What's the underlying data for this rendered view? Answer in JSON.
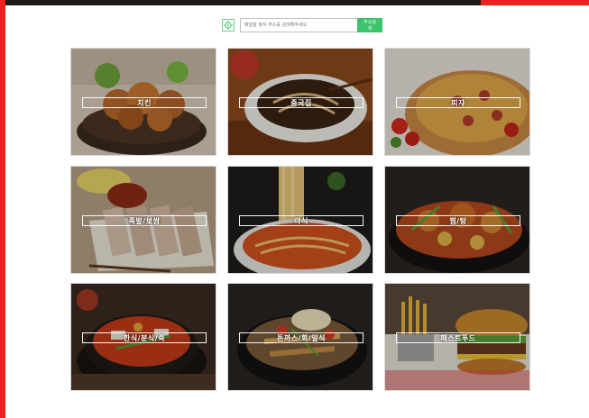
{
  "search": {
    "placeholder": "배달을 놓지 주소를 검색해주세요",
    "button_label": "주소검색"
  },
  "categories": [
    {
      "label": "치킨",
      "icon": "fried-chicken-image"
    },
    {
      "label": "중국집",
      "icon": "jjajangmyeon-image"
    },
    {
      "label": "피자",
      "icon": "pizza-image"
    },
    {
      "label": "족발/보쌈",
      "icon": "bossam-image"
    },
    {
      "label": "야식",
      "icon": "ramen-image"
    },
    {
      "label": "찜/탕",
      "icon": "braised-dish-image"
    },
    {
      "label": "한식/분식/죽",
      "icon": "stew-image"
    },
    {
      "label": "돈까스/회/일식",
      "icon": "donkatsu-bowl-image"
    },
    {
      "label": "패스트푸드",
      "icon": "burger-fries-image"
    }
  ],
  "colors": {
    "frame_border": "#e8231f",
    "search_button": "#3cc46a"
  }
}
